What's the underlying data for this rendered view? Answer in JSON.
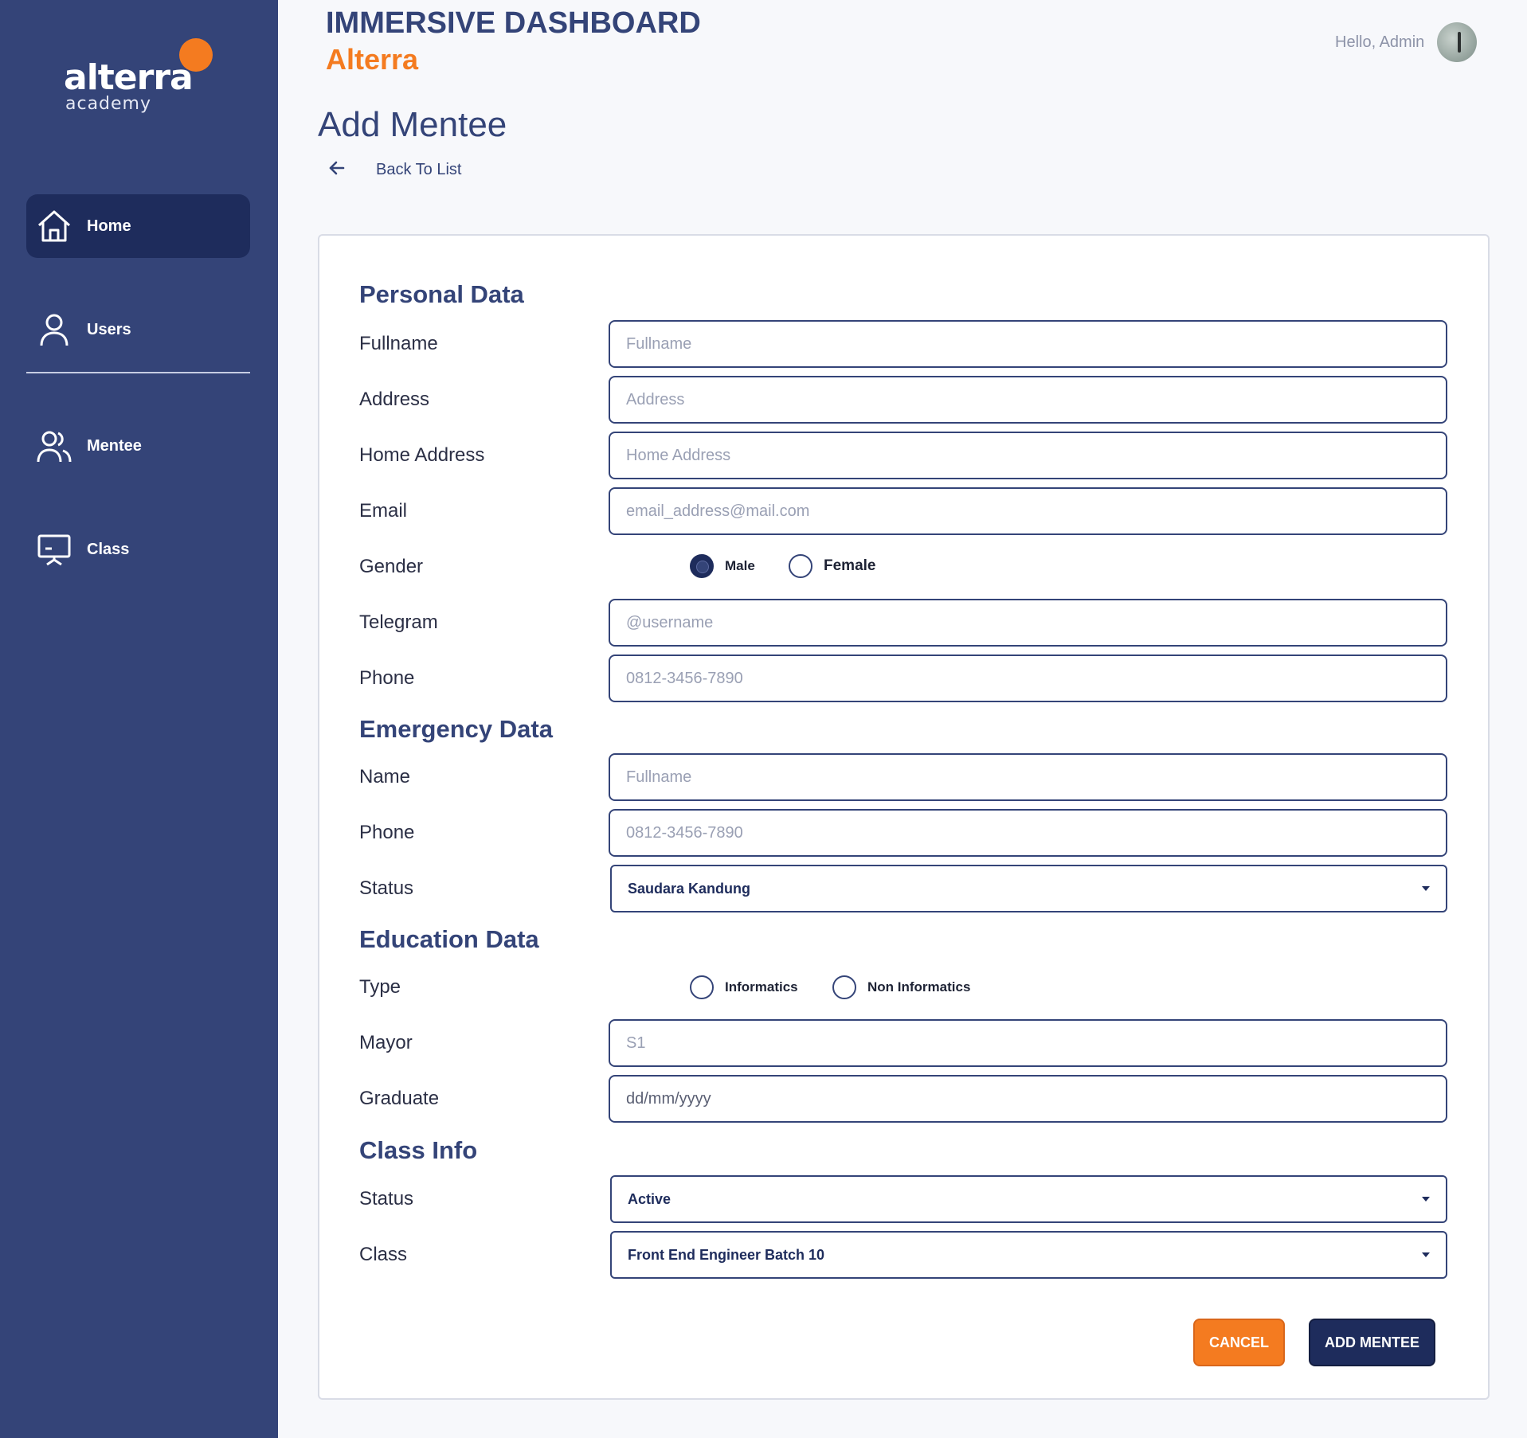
{
  "sidebar": {
    "logo": {
      "word": "alterra",
      "sub": "academy"
    },
    "items": [
      {
        "label": "Home",
        "icon": "home-icon",
        "active": true
      },
      {
        "label": "Users",
        "icon": "user-icon",
        "active": false
      },
      {
        "label": "Mentee",
        "icon": "users-group-icon",
        "active": false
      },
      {
        "label": "Class",
        "icon": "presentation-icon",
        "active": false
      }
    ]
  },
  "header": {
    "title": "IMMERSIVE DASHBOARD",
    "subtitle": "Alterra",
    "greeting": "Hello, Admin"
  },
  "page": {
    "title": "Add Mentee",
    "back_label": "Back To List"
  },
  "form": {
    "personal": {
      "title": "Personal Data",
      "fullname": {
        "label": "Fullname",
        "placeholder": "Fullname"
      },
      "address": {
        "label": "Address",
        "placeholder": "Address"
      },
      "home_address": {
        "label": "Home Address",
        "placeholder": "Home Address"
      },
      "email": {
        "label": "Email",
        "placeholder": "email_address@mail.com"
      },
      "gender": {
        "label": "Gender",
        "options": [
          "Male",
          "Female"
        ],
        "selected": "Male"
      },
      "telegram": {
        "label": "Telegram",
        "placeholder": "@username"
      },
      "phone": {
        "label": "Phone",
        "placeholder": "0812-3456-7890"
      }
    },
    "emergency": {
      "title": "Emergency Data",
      "name": {
        "label": "Name",
        "placeholder": "Fullname"
      },
      "phone": {
        "label": "Phone",
        "placeholder": "0812-3456-7890"
      },
      "status": {
        "label": "Status",
        "value": "Saudara Kandung"
      }
    },
    "education": {
      "title": "Education Data",
      "type": {
        "label": "Type",
        "options": [
          "Informatics",
          "Non Informatics"
        ],
        "selected": null
      },
      "mayor": {
        "label": "Mayor",
        "placeholder": "S1"
      },
      "graduate": {
        "label": "Graduate",
        "value": "dd/mm/yyyy"
      }
    },
    "class_info": {
      "title": "Class Info",
      "status": {
        "label": "Status",
        "value": "Active"
      },
      "class": {
        "label": "Class",
        "value": "Front End Engineer Batch 10"
      }
    },
    "buttons": {
      "cancel": "CANCEL",
      "submit": "ADD MENTEE"
    }
  },
  "colors": {
    "sidebar": "#344478",
    "active_nav": "#1e2c5c",
    "accent": "#f47b20",
    "primary_text": "#344478"
  }
}
